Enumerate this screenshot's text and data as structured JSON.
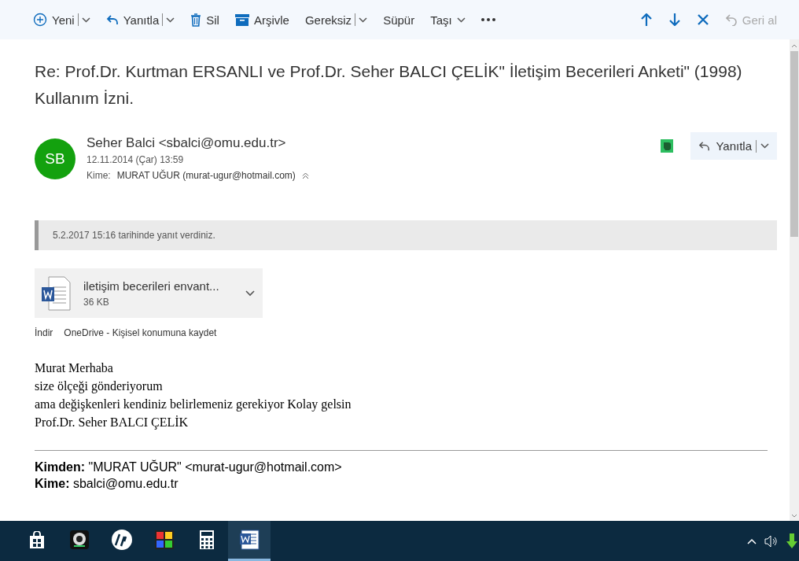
{
  "toolbar": {
    "items": [
      {
        "kind": "plus",
        "label": "Yeni",
        "dropdown": true,
        "split": true
      },
      {
        "kind": "reply",
        "label": "Yanıtla",
        "dropdown": true,
        "split": true
      },
      {
        "kind": "trash",
        "label": "Sil",
        "dropdown": false,
        "split": false
      },
      {
        "kind": "archive",
        "label": "Arşivle",
        "dropdown": false,
        "split": false
      },
      {
        "kind": "text",
        "label": "Gereksiz",
        "dropdown": true,
        "split": true
      },
      {
        "kind": "text",
        "label": "Süpür",
        "dropdown": false,
        "split": false
      },
      {
        "kind": "text",
        "label": "Taşı",
        "dropdown": true,
        "split": false
      },
      {
        "kind": "more",
        "dropdown": false,
        "split": false
      }
    ],
    "nav": [
      {
        "kind": "up",
        "disabled": false
      },
      {
        "kind": "down",
        "disabled": false
      },
      {
        "kind": "close",
        "disabled": false
      },
      {
        "kind": "undo",
        "label": "Geri al",
        "disabled": true
      }
    ]
  },
  "message": {
    "subject": "Re: Prof.Dr. Kurtman ERSANLI ve Prof.Dr. Seher BALCI ÇELİK\" İletişim Becerileri Anketi\" (1998) Kullanım İzni.",
    "avatar": "SB",
    "sender": "Seher Balci <sbalci@omu.edu.tr>",
    "date": "12.11.2014 (Çar) 13:59",
    "to_label": "Kime:",
    "to": "MURAT UĞUR (murat-ugur@hotmail.com)",
    "reply_button": "Yanıtla",
    "info": "5.2.2017 15:16 tarihinde yanıt verdiniz.",
    "attachment": {
      "name": "iletişim becerileri envant...",
      "size": "36 KB"
    },
    "attachment_actions": [
      "İndir",
      "OneDrive - Kişisel konumuna kaydet"
    ],
    "body": [
      "Murat Merhaba",
      "size ölçeği gönderiyorum",
      "ama değişkenleri kendiniz belirlemeniz gerekiyor Kolay gelsin",
      "Prof.Dr. Seher BALCI ÇELİK"
    ],
    "quoted": [
      {
        "label": "Kimden:",
        "value": "\"MURAT UĞUR\" <murat-ugur@hotmail.com>"
      },
      {
        "label": "Kime:",
        "value": "sbalci@omu.edu.tr"
      }
    ]
  },
  "taskbar": {
    "apps": [
      {
        "kind": "store",
        "selected": false
      },
      {
        "kind": "camera",
        "selected": false
      },
      {
        "kind": "circle-logo",
        "selected": false
      },
      {
        "kind": "puzzle",
        "selected": false
      },
      {
        "kind": "calculator",
        "selected": false
      },
      {
        "kind": "word",
        "selected": true
      }
    ]
  }
}
